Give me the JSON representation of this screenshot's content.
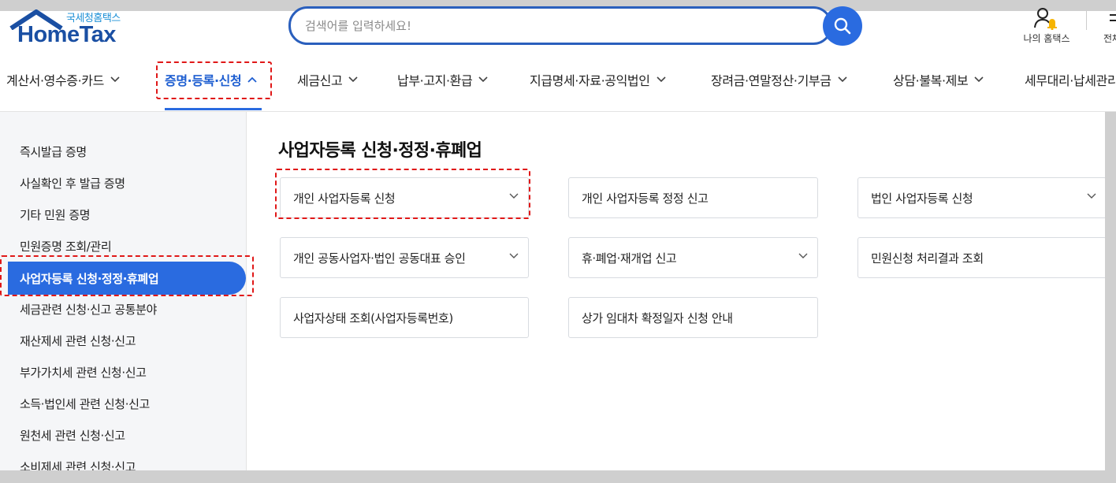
{
  "logo": {
    "subtitle": "국세청홈택스",
    "name": "HomeTax"
  },
  "search": {
    "placeholder": "검색어를 입력하세요!"
  },
  "header": {
    "myhome_label": "나의 홈택스",
    "allmenu_label": "전체"
  },
  "nav": {
    "items": [
      {
        "label": "계산서·영수증·카드"
      },
      {
        "label": "증명·등록·신청"
      },
      {
        "label": "세금신고"
      },
      {
        "label": "납부·고지·환급"
      },
      {
        "label": "지급명세·자료·공익법인"
      },
      {
        "label": "장려금·연말정산·기부금"
      },
      {
        "label": "상담·불복·제보"
      },
      {
        "label": "세무대리·납세관리"
      }
    ],
    "active_index": 1
  },
  "sidebar": {
    "items": [
      {
        "label": "즉시발급 증명"
      },
      {
        "label": "사실확인 후 발급 증명"
      },
      {
        "label": "기타 민원 증명"
      },
      {
        "label": "민원증명 조회/관리"
      },
      {
        "label": "사업자등록 신청·정정·휴폐업"
      },
      {
        "label": "세금관련 신청·신고 공통분야"
      },
      {
        "label": "재산제세 관련 신청·신고"
      },
      {
        "label": "부가가치세 관련 신청·신고"
      },
      {
        "label": "소득·법인세 관련 신청·신고"
      },
      {
        "label": "원천세 관련 신청·신고"
      },
      {
        "label": "소비제세 관련 신청·신고"
      }
    ],
    "active_index": 4
  },
  "content": {
    "title": "사업자등록 신청·정정·휴폐업",
    "cards": [
      {
        "label": "개인 사업자등록 신청",
        "has_chevron": true
      },
      {
        "label": "개인 사업자등록 정정 신고",
        "has_chevron": false
      },
      {
        "label": "법인 사업자등록 신청",
        "has_chevron": true
      },
      {
        "label": "개인 공동사업자·법인 공동대표 승인",
        "has_chevron": true
      },
      {
        "label": "휴·폐업·재개업 신고",
        "has_chevron": true
      },
      {
        "label": "민원신청 처리결과 조회",
        "has_chevron": false
      },
      {
        "label": "사업자상태 조회(사업자등록번호)",
        "has_chevron": false
      },
      {
        "label": "상가 임대차 확정일자 신청 안내",
        "has_chevron": false
      }
    ]
  },
  "colors": {
    "accent": "#2a6be0",
    "brand": "#1a4fa3",
    "highlight_dash": "#e01818"
  }
}
